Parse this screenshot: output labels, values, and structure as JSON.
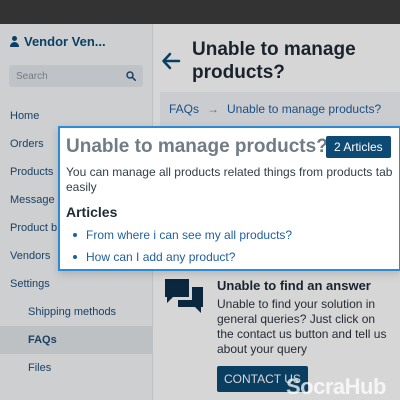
{
  "sidebar": {
    "vendor_name": "Vendor Ven...",
    "search_placeholder": "Search",
    "items": [
      {
        "label": "Home"
      },
      {
        "label": "Orders"
      },
      {
        "label": "Products"
      },
      {
        "label": "Message c"
      },
      {
        "label": "Product b"
      },
      {
        "label": "Vendors"
      },
      {
        "label": "Settings"
      },
      {
        "label": "Shipping methods"
      },
      {
        "label": "FAQs"
      },
      {
        "label": "Files"
      }
    ]
  },
  "main": {
    "title": "Unable to manage products?",
    "breadcrumb": {
      "root": "FAQs",
      "separator": "→",
      "current": "Unable to manage products?"
    }
  },
  "popup": {
    "title": "Unable to manage products?",
    "badge": "2 Articles",
    "description": "You can manage all products related things from products tab easily",
    "articles_heading": "Articles",
    "articles": [
      "From where i can see my all products?",
      "How can I add any product?"
    ]
  },
  "help": {
    "title": "Unable to find an answer",
    "text": "Unable to find your solution in general queries? Just click on the contact us button and tell us about your query",
    "button": "CONTACT US"
  },
  "watermark": "SocraHub",
  "colors": {
    "primary": "#0d4a74",
    "link": "#1f5f9f",
    "popup_border": "#2a8bd8"
  }
}
